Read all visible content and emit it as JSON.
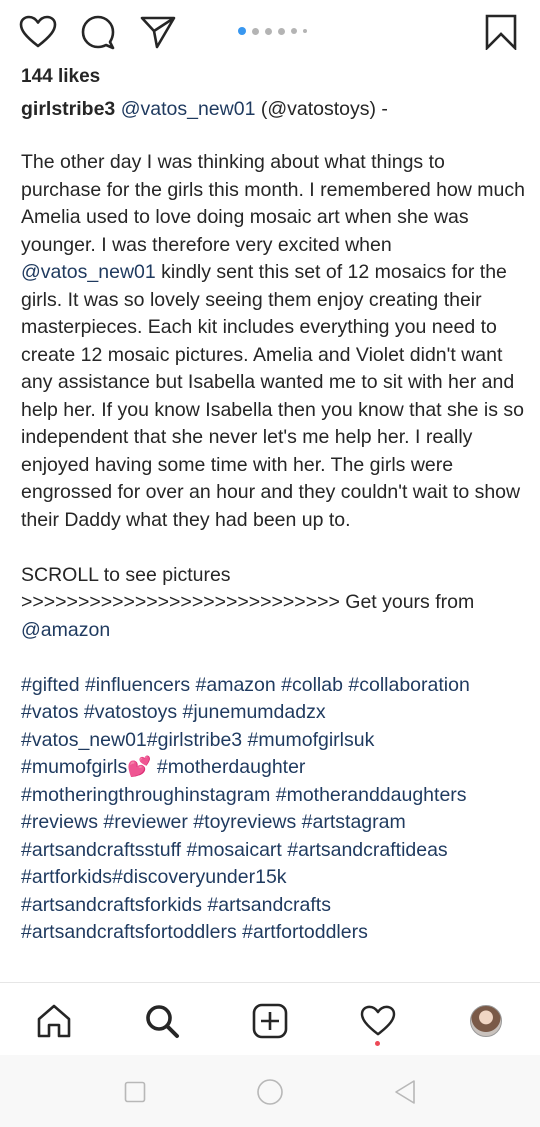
{
  "post": {
    "likes": "144 likes",
    "username": "girlstribe3",
    "mention": "@vatos_new01",
    "byline_rest": " (@vatostoys) -"
  },
  "carousel": {
    "dot_count": 6,
    "active_index": 0
  },
  "caption": {
    "line1_before": "The other day I was thinking about what things to purchase for the girls this month. I remembered how much Amelia used to love doing mosaic art when she was younger. I was therefore very excited when ",
    "line1_mention": "@vatos_new01",
    "line1_after": " kindly sent this set of 12 mosaics for the girls. It was so lovely seeing them enjoy creating their masterpieces. Each kit includes everything you need to create 12 mosaic pictures.  Amelia and Violet didn't want any assistance but Isabella wanted me to sit with her and help her. If you know Isabella then you know that she is so independent that she never let's me help her. I really enjoyed having some time with her. The girls were engrossed for over an hour and they couldn't wait to show their Daddy what they had been up to.",
    "scroll_text": "SCROLL to see pictures",
    "arrows_text": ">>>>>>>>>>>>>>>>>>>>>>>>>>>> Get yours from",
    "amazon_mention": "@amazon"
  },
  "hashtags": {
    "line1": "#gifted #influencers #amazon #collab #collaboration",
    "line2": "#vatos #vatostoys #junemumdadzx",
    "line3": "#vatos_new01#girlstribe3 #mumofgirlsuk",
    "line4a": "#mumofgirls",
    "line4_emoji": "💕",
    "line4b": " #motherdaughter",
    "line5": "#motheringthroughinstagram #motheranddaughters",
    "line6": "#reviews #reviewer #toyreviews #artstagram",
    "line7": "#artsandcraftsstuff #mosaicart #artsandcraftideas",
    "line8": "#artforkids#discoveryunder15k",
    "line9": "#artsandcraftsforkids #artsandcrafts",
    "line10": "#artsandcraftsfortoddlers #artfortoddlers"
  },
  "icons": {
    "like": "heart-outline-icon",
    "comment": "comment-icon",
    "share": "paper-plane-icon",
    "save": "bookmark-icon",
    "home": "home-icon",
    "search": "search-icon",
    "new_post": "plus-square-icon",
    "activity": "heart-outline-icon",
    "profile": "avatar"
  },
  "colors": {
    "link": "#1f3a5f",
    "text": "#262626",
    "active_dot": "#3897f0",
    "notification": "#ed4956"
  }
}
